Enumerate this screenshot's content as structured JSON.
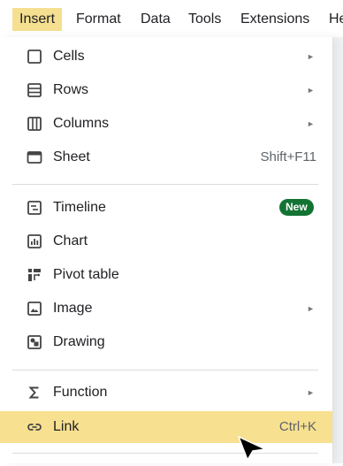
{
  "menubar": {
    "items": [
      {
        "label": "Insert"
      },
      {
        "label": "Format"
      },
      {
        "label": "Data"
      },
      {
        "label": "Tools"
      },
      {
        "label": "Extensions"
      },
      {
        "label": "He"
      }
    ]
  },
  "insert_menu": {
    "items": [
      {
        "label": "Cells",
        "icon": "cells-icon",
        "submenu": true
      },
      {
        "label": "Rows",
        "icon": "rows-icon",
        "submenu": true
      },
      {
        "label": "Columns",
        "icon": "columns-icon",
        "submenu": true
      },
      {
        "label": "Sheet",
        "icon": "sheet-icon",
        "shortcut": "Shift+F11"
      },
      {
        "label": "Timeline",
        "icon": "timeline-icon",
        "badge": "New"
      },
      {
        "label": "Chart",
        "icon": "chart-icon"
      },
      {
        "label": "Pivot table",
        "icon": "pivot-table-icon"
      },
      {
        "label": "Image",
        "icon": "image-icon",
        "submenu": true
      },
      {
        "label": "Drawing",
        "icon": "drawing-icon"
      },
      {
        "label": "Function",
        "icon": "function-icon",
        "submenu": true
      },
      {
        "label": "Link",
        "icon": "link-icon",
        "shortcut": "Ctrl+K",
        "highlighted": true
      }
    ],
    "submenu_arrow": "►"
  },
  "colors": {
    "active_menu": "#f5df90",
    "highlight": "#f7e08f",
    "badge": "#137333"
  }
}
